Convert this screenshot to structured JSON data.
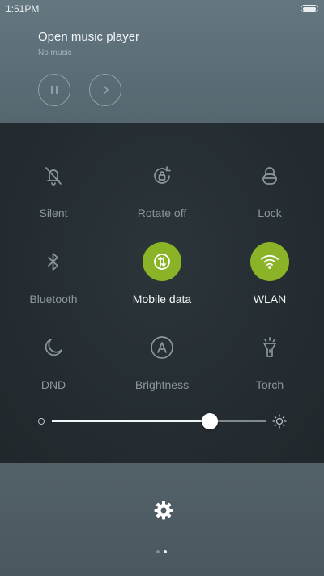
{
  "status_bar": {
    "time": "1:51PM"
  },
  "music": {
    "title": "Open music player",
    "subtitle": "No music",
    "pause_icon": "pause-icon",
    "next_icon": "chevron-right-icon"
  },
  "toggles": [
    {
      "label": "Silent",
      "icon": "bell-off-icon",
      "active": false
    },
    {
      "label": "Rotate off",
      "icon": "rotate-lock-icon",
      "active": false
    },
    {
      "label": "Lock",
      "icon": "lock-icon",
      "active": false
    },
    {
      "label": "Bluetooth",
      "icon": "bluetooth-icon",
      "active": false
    },
    {
      "label": "Mobile data",
      "icon": "mobile-data-icon",
      "active": true
    },
    {
      "label": "WLAN",
      "icon": "wifi-icon",
      "active": true
    },
    {
      "label": "DND",
      "icon": "moon-icon",
      "active": false
    },
    {
      "label": "Brightness",
      "icon": "auto-brightness-icon",
      "active": false
    },
    {
      "label": "Torch",
      "icon": "torch-icon",
      "active": false
    }
  ],
  "brightness": {
    "level_fraction": 0.74
  },
  "colors": {
    "accent_on": "#8ab327",
    "label_off": "#8a979d",
    "label_on": "#f3f6f7"
  },
  "bottom": {
    "settings_icon": "gear-icon",
    "pages": 2,
    "current_page": 2
  }
}
